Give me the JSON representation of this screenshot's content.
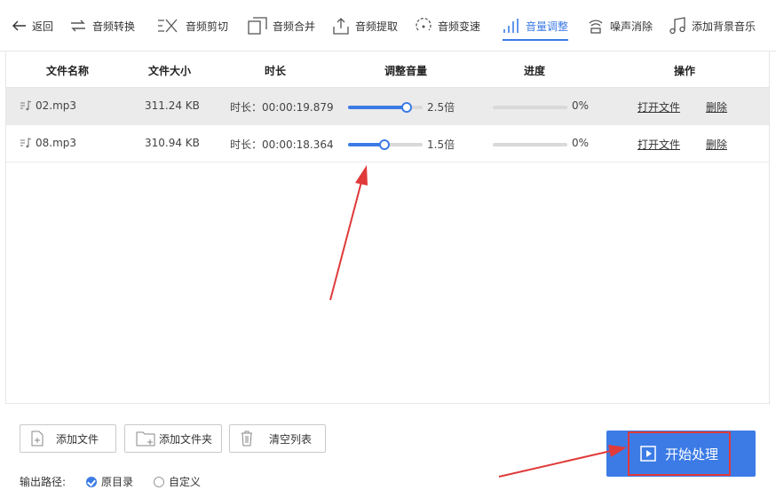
{
  "toolbar": {
    "back": "返回",
    "items": [
      {
        "label": "音频转换",
        "icon": "convert-icon"
      },
      {
        "label": "音频剪切",
        "icon": "scissors-icon"
      },
      {
        "label": "音频合并",
        "icon": "merge-icon"
      },
      {
        "label": "音频提取",
        "icon": "extract-icon"
      },
      {
        "label": "音频变速",
        "icon": "speed-icon"
      },
      {
        "label": "音量调整",
        "icon": "volume-bars-icon",
        "active": true
      },
      {
        "label": "噪声消除",
        "icon": "denoise-icon"
      },
      {
        "label": "添加背景音乐",
        "icon": "music-note-icon"
      }
    ]
  },
  "table": {
    "headers": {
      "name": "文件名称",
      "size": "文件大小",
      "duration": "时长",
      "volume": "调整音量",
      "progress": "进度",
      "actions": "操作"
    },
    "rows": [
      {
        "name": "02.mp3",
        "size": "311.24 KB",
        "duration": "时长：00:00:19.879",
        "volume_label": "2.5倍",
        "volume_level": 0.79,
        "progress_label": "0%",
        "progress": 0,
        "open": "打开文件",
        "delete": "删除",
        "selected": true
      },
      {
        "name": "08.mp3",
        "size": "310.94 KB",
        "duration": "时长：00:00:18.364",
        "volume_label": "1.5倍",
        "volume_level": 0.49,
        "progress_label": "0%",
        "progress": 0,
        "open": "打开文件",
        "delete": "删除",
        "selected": false
      }
    ]
  },
  "bottom": {
    "add_file": "添加文件",
    "add_folder": "添加文件夹",
    "clear_list": "清空列表",
    "output_label": "输出路径:",
    "output_options": [
      {
        "label": "原目录",
        "checked": true
      },
      {
        "label": "自定义",
        "checked": false
      }
    ],
    "start": "开始处理"
  },
  "colors": {
    "accent": "#3c7be6",
    "annotation": "#e03a3a"
  }
}
